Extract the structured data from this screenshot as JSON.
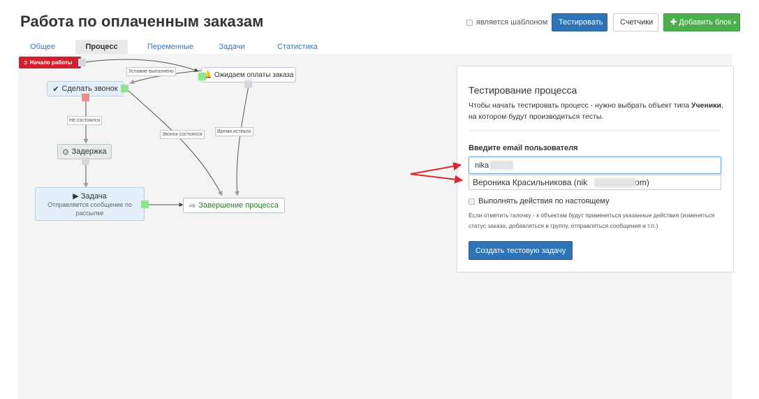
{
  "page": {
    "title": "Работа по оплаченным заказам"
  },
  "header": {
    "template_label": "является шаблоном",
    "test_button": "Тестировать",
    "counters_button": "Счетчики",
    "add_block_button": "Добавить блок",
    "add_block_icon": "plus-icon",
    "add_block_caret": "caret-down-icon"
  },
  "tabs": [
    {
      "label": "Общее",
      "active": false
    },
    {
      "label": "Процесс",
      "active": true
    },
    {
      "label": "Переменные",
      "active": false
    },
    {
      "label": "Задачи",
      "active": false
    },
    {
      "label": "Статистика",
      "active": false
    }
  ],
  "flow": {
    "start": {
      "label": "Начало работы",
      "icon": "sign-in-icon"
    },
    "call": {
      "label": "Сделать звонок",
      "icon": "check-icon"
    },
    "await": {
      "label": "Ожидаем оплаты заказа",
      "icon": "bell-icon"
    },
    "delay": {
      "label": "Задержка",
      "icon": "clock-icon"
    },
    "task": {
      "label": "Задача",
      "sub": "Отправляется сообщение по рассылке",
      "icon": "play-icon"
    },
    "finish": {
      "label": "Завершение процесса",
      "icon": "sign-out-icon"
    },
    "edge_labels": {
      "condition_met": "Условие выполнено",
      "not_happened": "Не состоялся",
      "call_happened": "Звонок состоялся",
      "time_expired": "Время истекло"
    },
    "colors": {
      "start": "#d0202e",
      "node_blue": "#e3f0fb",
      "node_grey": "#e5ece8",
      "finish_text": "#2a7a2a"
    }
  },
  "test_panel": {
    "title": "Тестирование процесса",
    "desc_prefix": "Чтобы начать тестировать процесс - нужно выбрать объект типа ",
    "desc_bold": "Ученики",
    "desc_suffix": ", на котором будут производиться тесты.",
    "email_label": "Введите email пользователя",
    "email_value": "nika",
    "suggestion_name": "Вероника Красильникова (nik",
    "suggestion_tail": "om)",
    "live_label": "Выполнять действия по настоящему",
    "live_help": "Если отметить галочку - к объектам будут применяться указанные действия (изменяться статус заказа, добавляться в группу, отправляться сообщения и т.п.)",
    "create_button": "Создать тестовую задачу"
  },
  "annotation": {
    "arrow_color": "#e0262c"
  }
}
